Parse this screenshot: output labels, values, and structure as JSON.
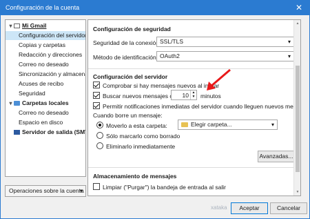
{
  "window": {
    "title": "Configuración de la cuenta",
    "close": "✕"
  },
  "sidebar": {
    "items": [
      {
        "label": "Mi Gmail",
        "type": "root",
        "icon": "mail-icon"
      },
      {
        "label": "Configuración del servidor",
        "type": "child",
        "selected": true
      },
      {
        "label": "Copias y carpetas",
        "type": "child"
      },
      {
        "label": "Redacción y direcciones",
        "type": "child"
      },
      {
        "label": "Correo no deseado",
        "type": "child"
      },
      {
        "label": "Sincronización y almacena...",
        "type": "child"
      },
      {
        "label": "Acuses de recibo",
        "type": "child"
      },
      {
        "label": "Seguridad",
        "type": "child"
      },
      {
        "label": "Carpetas locales",
        "type": "root",
        "icon": "folder-icon"
      },
      {
        "label": "Correo no deseado",
        "type": "child"
      },
      {
        "label": "Espacio en disco",
        "type": "child"
      },
      {
        "label": "Servidor de salida (SMTP)",
        "type": "root",
        "icon": "send-icon"
      }
    ],
    "operations_button": "Operaciones sobre la cuenta",
    "operations_arrow": "▾"
  },
  "security": {
    "title": "Configuración de seguridad",
    "connection_label": "Seguridad de la conexión:",
    "connection_value": "SSL/TLS",
    "auth_label": "Método de identificación:",
    "auth_value": "OAuth2"
  },
  "server": {
    "title": "Configuración del servidor",
    "check_on_start": "Comprobar si hay mensajes nuevos al iniciar",
    "check_every": "Buscar nuevos mensajes cada",
    "interval": "10",
    "minutes": "minutos",
    "push": "Permitir notificaciones inmediatas del servidor cuando lleguen nuevos mensajes",
    "on_delete": "Cuando borre un mensaje:",
    "move_to": "Moverlo a esta carpeta:",
    "folder_choice": "Elegir carpeta...",
    "mark_deleted": "Sólo marcarlo como borrado",
    "delete_now": "Eliminarlo inmediatamente",
    "advanced_button": "Avanzadas..."
  },
  "storage": {
    "title": "Almacenamiento de mensajes",
    "purge": "Limpiar (\"Purgar\") la bandeja de entrada al salir"
  },
  "footer": {
    "accept": "Aceptar",
    "cancel": "Cancelar"
  },
  "watermark": "xataka",
  "colors": {
    "titlebar": "#2b7bd1",
    "arrow": "#e8191a",
    "selection": "#cde6f7"
  }
}
